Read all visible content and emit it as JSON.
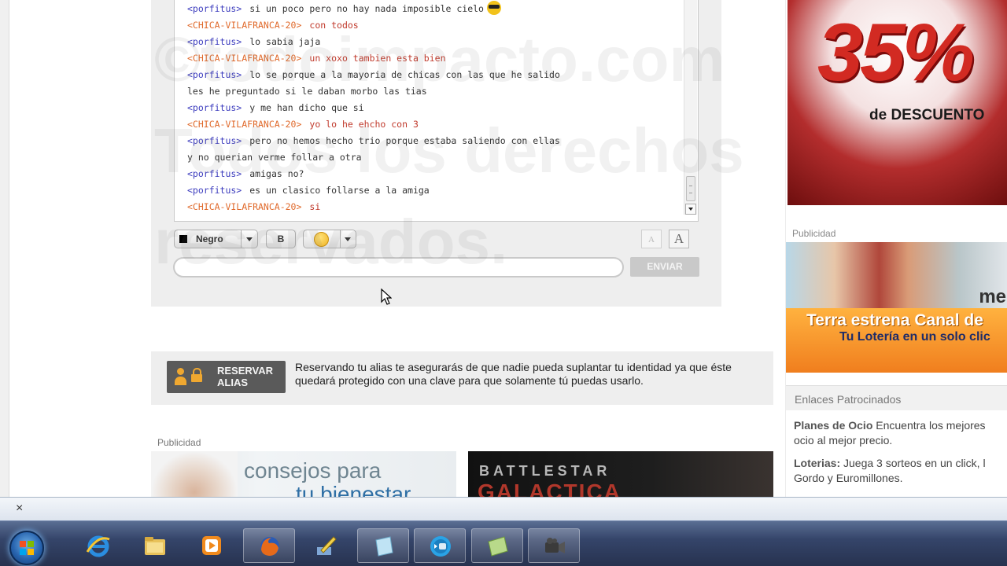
{
  "chat": {
    "lines": [
      {
        "nick": "<porfitus>",
        "text": "si un poco pero no hay nada imposible cielo",
        "who": "porfitus",
        "emoji": true
      },
      {
        "nick": "<CHICA-VILAFRANCA-20>",
        "text": "con todos",
        "who": "chica"
      },
      {
        "nick": "<porfitus>",
        "text": "lo sabia jaja",
        "who": "porfitus"
      },
      {
        "nick": "<CHICA-VILAFRANCA-20>",
        "text": "un xoxo tambien esta bien",
        "who": "chica"
      },
      {
        "nick": "<porfitus>",
        "text": "lo se porque a la mayoria de chicas con las que he salido",
        "who": "porfitus"
      },
      {
        "nick": "",
        "text": "les he preguntado si le daban morbo las tias",
        "who": "porfitus"
      },
      {
        "nick": "<porfitus>",
        "text": "y me han dicho que si",
        "who": "porfitus"
      },
      {
        "nick": "<CHICA-VILAFRANCA-20>",
        "text": "yo lo he ehcho con 3",
        "who": "chica"
      },
      {
        "nick": "<porfitus>",
        "text": "pero no hemos hecho trio porque estaba saliendo con ellas",
        "who": "porfitus"
      },
      {
        "nick": "",
        "text": "y no querian verme follar a otra",
        "who": "porfitus"
      },
      {
        "nick": "<porfitus>",
        "text": "amigas no?",
        "who": "porfitus"
      },
      {
        "nick": "<porfitus>",
        "text": "es un clasico follarse a la amiga",
        "who": "porfitus"
      },
      {
        "nick": "<CHICA-VILAFRANCA-20>",
        "text": "si",
        "who": "chica"
      }
    ]
  },
  "toolbar": {
    "color_label": "Negro",
    "bold_label": "B",
    "font_decrease": "A",
    "font_increase": "A",
    "send_label": "ENVIAR",
    "input_value": ""
  },
  "reserve": {
    "button_label": "RESERVAR ALIAS",
    "description": "Reservando tu alias te asegurarás de que nadie pueda suplantar tu identidad ya que éste quedará protegido con una clave para que solamente tú puedas usarlo."
  },
  "ads": {
    "publicidad_label": "Publicidad",
    "consejos_line1": "consejos para",
    "consejos_line2": "tu bienestar",
    "battlestar_line1": "BATTLESTAR",
    "battlestar_line2": "GALACTICA",
    "discount_value": "35%",
    "discount_text": "de DESCUENTO",
    "terra_logo": "me",
    "terra_line1": "Terra estrena Canal de",
    "terra_line2": "Tu Lotería en un solo clic"
  },
  "sponsored": {
    "title": "Enlaces Patrocinados",
    "links": [
      {
        "title": "Planes de Ocio",
        "line1": " Encuentra los mejores",
        "line2": "ocio al mejor precio."
      },
      {
        "title": "Loterias:",
        "line1": " Juega 3 sorteos en un click, l",
        "line2": "Gordo y Euromillones."
      }
    ]
  },
  "watermark": "©todoimpacto.com Todos los derechos reservados.",
  "findbar": {
    "close_symbol": "×"
  },
  "colors": {
    "nick_porfitus": "#3c3cbe",
    "nick_chica": "#e06a2c",
    "msg_chica": "#c0392b",
    "reserve_button": "#5a5a5a",
    "accent_orange": "#f0a830"
  },
  "taskbar_icons": [
    "start-orb",
    "internet-explorer-icon",
    "libraries-folder-icon",
    "media-player-icon",
    "firefox-icon",
    "tool-icon",
    "notepad-icon",
    "bs-player-icon",
    "note-icon",
    "video-camera-icon"
  ]
}
